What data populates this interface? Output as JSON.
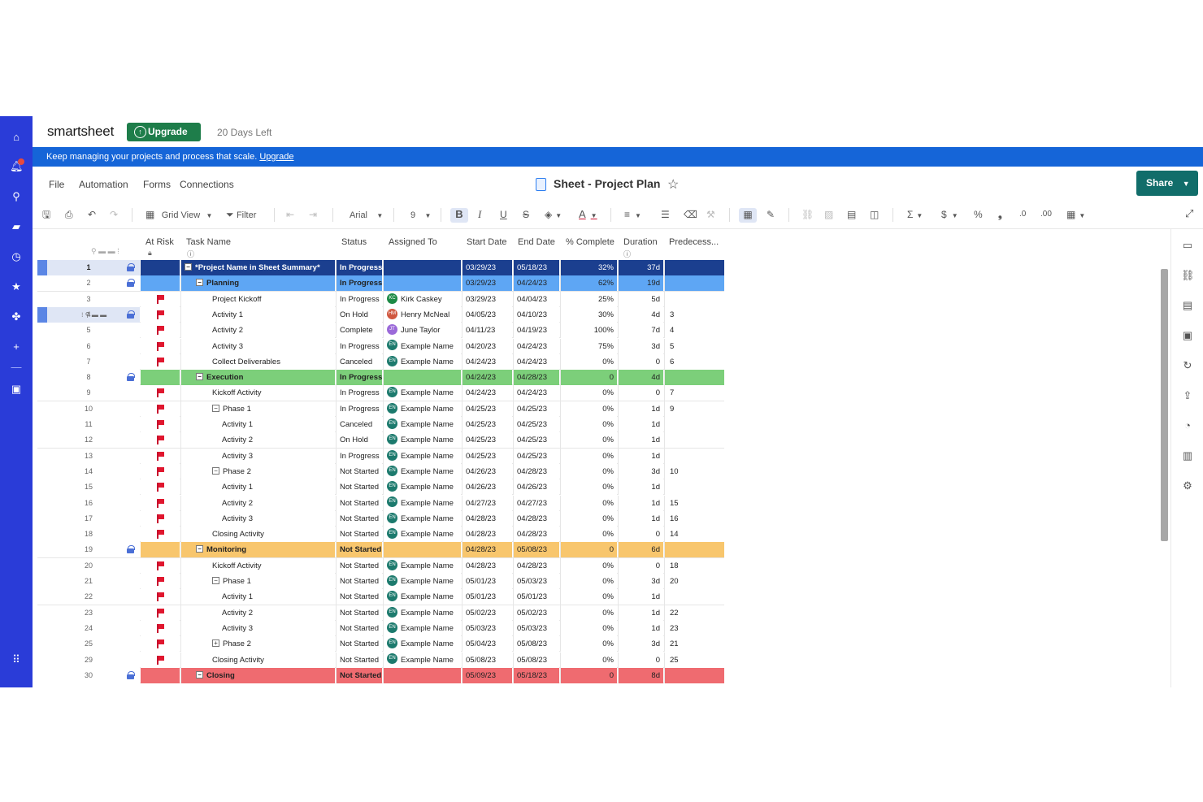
{
  "app": {
    "logo": "smartsheet",
    "upgrade_label": "Upgrade",
    "days_left": "20 Days Left"
  },
  "banner": {
    "text": "Keep managing your projects and process that scale.",
    "link": "Upgrade"
  },
  "menu": {
    "items": [
      "File",
      "Automation",
      "Forms",
      "Connections"
    ],
    "sheet_title": "Sheet - Project Plan",
    "share_label": "Share"
  },
  "toolbar": {
    "view_label": "Grid View",
    "filter_label": "Filter",
    "font": "Arial",
    "font_size": "9"
  },
  "columns": [
    "At Risk",
    "Task Name",
    "Status",
    "Assigned To",
    "Start Date",
    "End Date",
    "% Complete",
    "Duration",
    "Predecess..."
  ],
  "colors": {
    "summary": "#1b3f8f",
    "planning": "#5ea6f4",
    "execution": "#7ccf7a",
    "monitoring": "#f8c66d",
    "closing": "#ef6b70",
    "rail": "#2a3cd8",
    "banner": "#1565d8"
  },
  "rows": [
    {
      "num": "1",
      "task": "*Project Name in Sheet Summary*",
      "status": "In Progress",
      "assigned": "",
      "initials": "",
      "start": "03/29/23",
      "end": "05/18/23",
      "pct": "32%",
      "dur": "37d",
      "pred": "",
      "level": 0,
      "type": "summary",
      "flag": false,
      "lock": true
    },
    {
      "num": "2",
      "task": "Planning",
      "status": "In Progress",
      "assigned": "",
      "initials": "",
      "start": "03/29/23",
      "end": "04/24/23",
      "pct": "62%",
      "dur": "19d",
      "pred": "",
      "level": 1,
      "type": "planning",
      "flag": false,
      "lock": true
    },
    {
      "num": "3",
      "task": "Project Kickoff",
      "status": "In Progress",
      "assigned": "Kirk Caskey",
      "initials": "KC",
      "start": "03/29/23",
      "end": "04/04/23",
      "pct": "25%",
      "dur": "5d",
      "pred": "",
      "level": 2,
      "flag": true
    },
    {
      "num": "4",
      "task": "Activity 1",
      "status": "On Hold",
      "assigned": "Henry McNeal",
      "initials": "HM",
      "start": "04/05/23",
      "end": "04/10/23",
      "pct": "30%",
      "dur": "4d",
      "pred": "3",
      "level": 2,
      "flag": true,
      "lock": true,
      "selected": true
    },
    {
      "num": "5",
      "task": "Activity 2",
      "status": "Complete",
      "assigned": "June Taylor",
      "initials": "JT",
      "start": "04/11/23",
      "end": "04/19/23",
      "pct": "100%",
      "dur": "7d",
      "pred": "4",
      "level": 2,
      "flag": true
    },
    {
      "num": "6",
      "task": "Activity 3",
      "status": "In Progress",
      "assigned": "Example Name",
      "initials": "EN",
      "start": "04/20/23",
      "end": "04/24/23",
      "pct": "75%",
      "dur": "3d",
      "pred": "5",
      "level": 2,
      "flag": true
    },
    {
      "num": "7",
      "task": "Collect Deliverables",
      "status": "Canceled",
      "assigned": "Example Name",
      "initials": "EN",
      "start": "04/24/23",
      "end": "04/24/23",
      "pct": "0%",
      "dur": "0",
      "pred": "6",
      "level": 2,
      "flag": true
    },
    {
      "num": "8",
      "task": "Execution",
      "status": "In Progress",
      "assigned": "",
      "initials": "",
      "start": "04/24/23",
      "end": "04/28/23",
      "pct": "0",
      "dur": "4d",
      "pred": "",
      "level": 1,
      "type": "execution",
      "flag": false,
      "lock": true
    },
    {
      "num": "9",
      "task": "Kickoff Activity",
      "status": "In Progress",
      "assigned": "Example Name",
      "initials": "EN",
      "start": "04/24/23",
      "end": "04/24/23",
      "pct": "0%",
      "dur": "0",
      "pred": "7",
      "level": 2,
      "flag": true
    },
    {
      "num": "10",
      "task": "Phase 1",
      "status": "In Progress",
      "assigned": "Example Name",
      "initials": "EN",
      "start": "04/25/23",
      "end": "04/25/23",
      "pct": "0%",
      "dur": "1d",
      "pred": "9",
      "level": 2,
      "flag": true,
      "toggle": "−"
    },
    {
      "num": "11",
      "task": "Activity 1",
      "status": "Canceled",
      "assigned": "Example Name",
      "initials": "EN",
      "start": "04/25/23",
      "end": "04/25/23",
      "pct": "0%",
      "dur": "1d",
      "pred": "",
      "level": 3,
      "flag": true
    },
    {
      "num": "12",
      "task": "Activity 2",
      "status": "On Hold",
      "assigned": "Example Name",
      "initials": "EN",
      "start": "04/25/23",
      "end": "04/25/23",
      "pct": "0%",
      "dur": "1d",
      "pred": "",
      "level": 3,
      "flag": true
    },
    {
      "num": "13",
      "task": "Activity 3",
      "status": "In Progress",
      "assigned": "Example Name",
      "initials": "EN",
      "start": "04/25/23",
      "end": "04/25/23",
      "pct": "0%",
      "dur": "1d",
      "pred": "",
      "level": 3,
      "flag": true
    },
    {
      "num": "14",
      "task": "Phase 2",
      "status": "Not Started",
      "assigned": "Example Name",
      "initials": "EN",
      "start": "04/26/23",
      "end": "04/28/23",
      "pct": "0%",
      "dur": "3d",
      "pred": "10",
      "level": 2,
      "flag": true,
      "toggle": "−"
    },
    {
      "num": "15",
      "task": "Activity 1",
      "status": "Not Started",
      "assigned": "Example Name",
      "initials": "EN",
      "start": "04/26/23",
      "end": "04/26/23",
      "pct": "0%",
      "dur": "1d",
      "pred": "",
      "level": 3,
      "flag": true
    },
    {
      "num": "16",
      "task": "Activity 2",
      "status": "Not Started",
      "assigned": "Example Name",
      "initials": "EN",
      "start": "04/27/23",
      "end": "04/27/23",
      "pct": "0%",
      "dur": "1d",
      "pred": "15",
      "level": 3,
      "flag": true
    },
    {
      "num": "17",
      "task": "Activity 3",
      "status": "Not Started",
      "assigned": "Example Name",
      "initials": "EN",
      "start": "04/28/23",
      "end": "04/28/23",
      "pct": "0%",
      "dur": "1d",
      "pred": "16",
      "level": 3,
      "flag": true
    },
    {
      "num": "18",
      "task": "Closing Activity",
      "status": "Not Started",
      "assigned": "Example Name",
      "initials": "EN",
      "start": "04/28/23",
      "end": "04/28/23",
      "pct": "0%",
      "dur": "0",
      "pred": "14",
      "level": 2,
      "flag": true
    },
    {
      "num": "19",
      "task": "Monitoring",
      "status": "Not Started",
      "assigned": "",
      "initials": "",
      "start": "04/28/23",
      "end": "05/08/23",
      "pct": "0",
      "dur": "6d",
      "pred": "",
      "level": 1,
      "type": "monitoring",
      "flag": false,
      "lock": true
    },
    {
      "num": "20",
      "task": "Kickoff Activity",
      "status": "Not Started",
      "assigned": "Example Name",
      "initials": "EN",
      "start": "04/28/23",
      "end": "04/28/23",
      "pct": "0%",
      "dur": "0",
      "pred": "18",
      "level": 2,
      "flag": true
    },
    {
      "num": "21",
      "task": "Phase 1",
      "status": "Not Started",
      "assigned": "Example Name",
      "initials": "EN",
      "start": "05/01/23",
      "end": "05/03/23",
      "pct": "0%",
      "dur": "3d",
      "pred": "20",
      "level": 2,
      "flag": true,
      "toggle": "−"
    },
    {
      "num": "22",
      "task": "Activity 1",
      "status": "Not Started",
      "assigned": "Example Name",
      "initials": "EN",
      "start": "05/01/23",
      "end": "05/01/23",
      "pct": "0%",
      "dur": "1d",
      "pred": "",
      "level": 3,
      "flag": true
    },
    {
      "num": "23",
      "task": "Activity 2",
      "status": "Not Started",
      "assigned": "Example Name",
      "initials": "EN",
      "start": "05/02/23",
      "end": "05/02/23",
      "pct": "0%",
      "dur": "1d",
      "pred": "22",
      "level": 3,
      "flag": true
    },
    {
      "num": "24",
      "task": "Activity 3",
      "status": "Not Started",
      "assigned": "Example Name",
      "initials": "EN",
      "start": "05/03/23",
      "end": "05/03/23",
      "pct": "0%",
      "dur": "1d",
      "pred": "23",
      "level": 3,
      "flag": true
    },
    {
      "num": "25",
      "task": "Phase 2",
      "status": "Not Started",
      "assigned": "Example Name",
      "initials": "EN",
      "start": "05/04/23",
      "end": "05/08/23",
      "pct": "0%",
      "dur": "3d",
      "pred": "21",
      "level": 2,
      "flag": true,
      "toggle": "+"
    },
    {
      "num": "29",
      "task": "Closing Activity",
      "status": "Not Started",
      "assigned": "Example Name",
      "initials": "EN",
      "start": "05/08/23",
      "end": "05/08/23",
      "pct": "0%",
      "dur": "0",
      "pred": "25",
      "level": 2,
      "flag": true
    },
    {
      "num": "30",
      "task": "Closing",
      "status": "Not Started",
      "assigned": "",
      "initials": "",
      "start": "05/09/23",
      "end": "05/18/23",
      "pct": "0",
      "dur": "8d",
      "pred": "",
      "level": 1,
      "type": "closing",
      "flag": false,
      "lock": true
    }
  ]
}
